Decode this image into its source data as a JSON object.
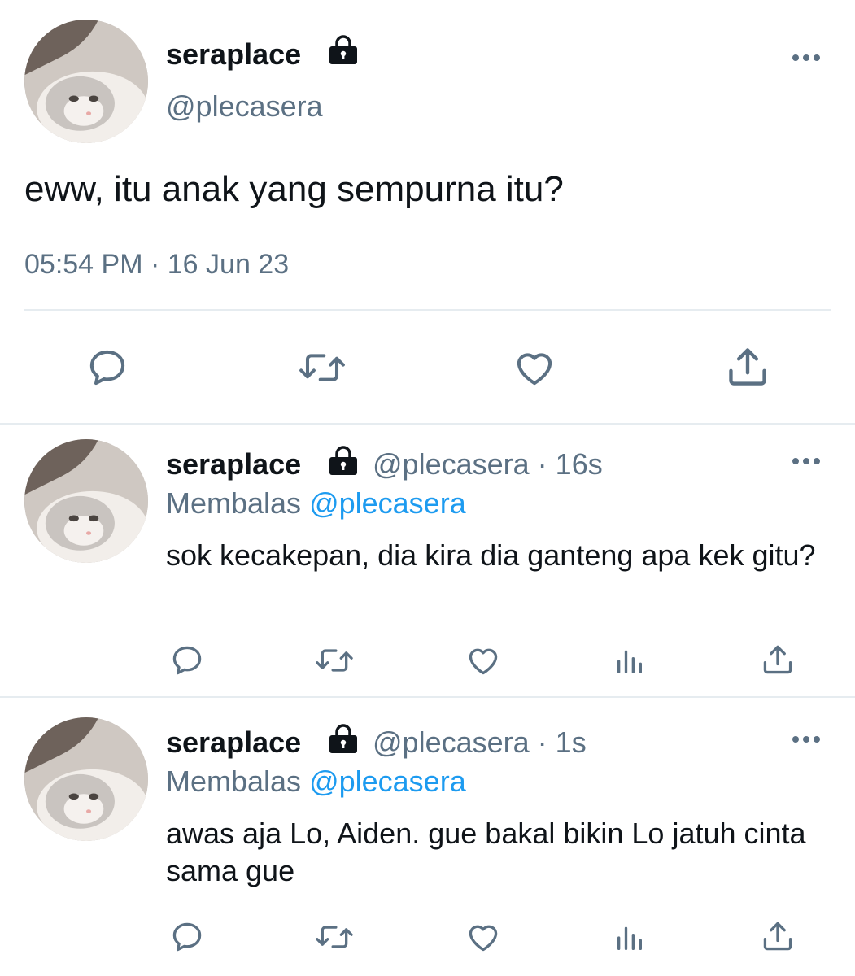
{
  "main_tweet": {
    "display_name": "seraplace",
    "handle": "@plecasera",
    "text": "eww, itu anak yang sempurna itu?",
    "time": "05:54 PM",
    "separator": "·",
    "date": "16 Jun 23",
    "actions": [
      "reply-icon",
      "retweet-icon",
      "like-icon",
      "share-icon"
    ]
  },
  "replies": [
    {
      "display_name": "seraplace",
      "handle": "@plecasera",
      "separator": "·",
      "age": "16s",
      "replying_label": "Membalas",
      "replying_to": "@plecasera",
      "text": "sok kecakepan, dia kira dia ganteng apa kek gitu?",
      "actions": [
        "reply-icon",
        "retweet-icon",
        "like-icon",
        "analytics-icon",
        "share-icon"
      ]
    },
    {
      "display_name": "seraplace",
      "handle": "@plecasera",
      "separator": "·",
      "age": "1s",
      "replying_label": "Membalas",
      "replying_to": "@plecasera",
      "text": "awas aja Lo, Aiden. gue bakal bikin Lo jatuh cinta sama gue",
      "actions": [
        "reply-icon",
        "retweet-icon",
        "like-icon",
        "analytics-icon",
        "share-icon"
      ]
    }
  ],
  "colors": {
    "text": "#0f1419",
    "secondary": "#5b7083",
    "link": "#1d9bf0",
    "divider": "#e6ecf0"
  }
}
